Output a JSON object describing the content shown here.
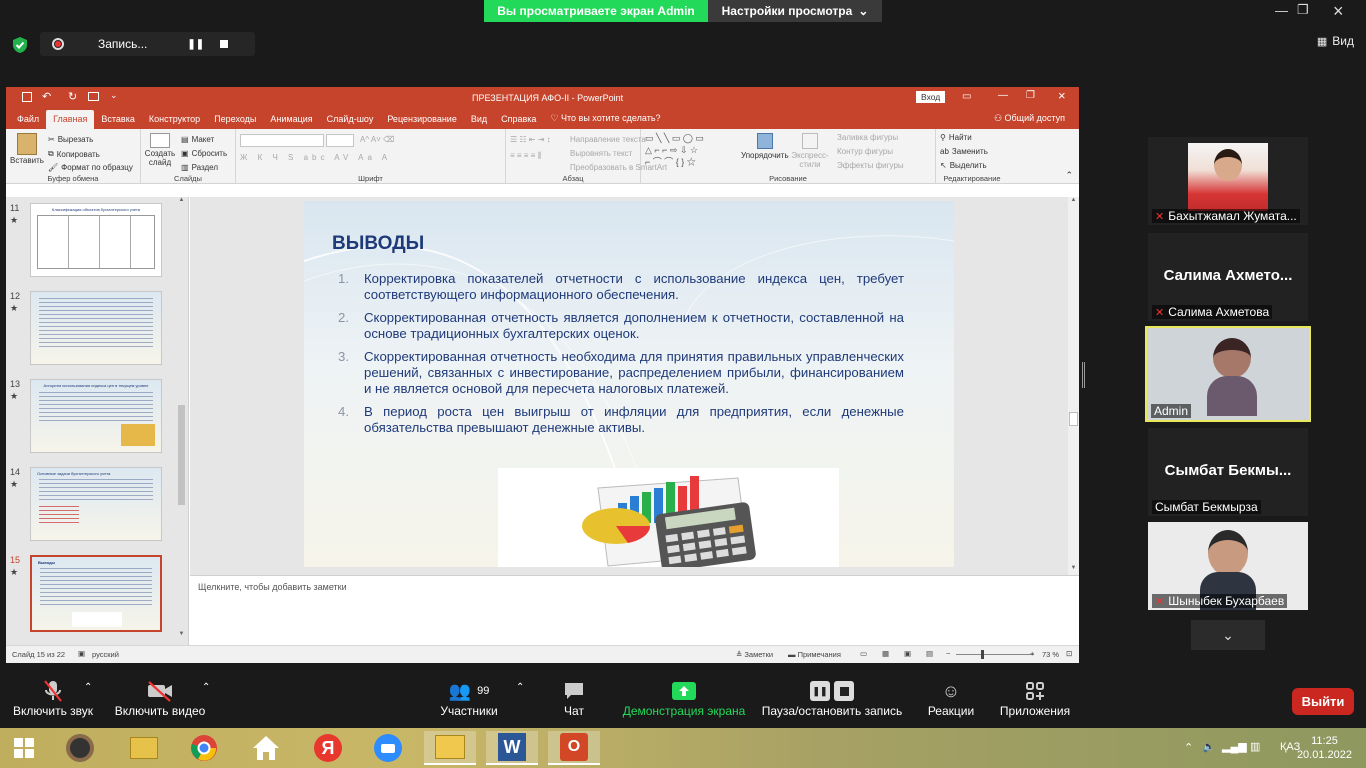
{
  "zoom": {
    "banner_text": "Вы просматриваете экран Admin",
    "view_options": "Настройки просмотра",
    "recording_label": "Запись...",
    "view_label": "Вид",
    "leave_label": "Выйти",
    "participants_count": "99",
    "toolbar": {
      "mute": "Включить звук",
      "video": "Включить видео",
      "participants": "Участники",
      "chat": "Чат",
      "share": "Демонстрация экрана",
      "record": "Пауза/остановить запись",
      "reactions": "Реакции",
      "apps": "Приложения"
    },
    "participants": [
      {
        "name": "Бахытжамал Жумата...",
        "big": "",
        "muted": true
      },
      {
        "name": "Салима Ахметова",
        "big": "Салима Ахмето...",
        "muted": true
      },
      {
        "name": "Admin",
        "big": "",
        "muted": false
      },
      {
        "name": "Сымбат Бекмырза",
        "big": "Сымбат Бекмы...",
        "muted": false
      },
      {
        "name": "Шыныбек Бухарбаев",
        "big": "",
        "muted": true
      }
    ]
  },
  "ppt": {
    "title": "ПРЕЗЕНТАЦИЯ АФО-II  -  PowerPoint",
    "signin": "Вход",
    "share": "Общий доступ",
    "tabs": [
      "Файл",
      "Главная",
      "Вставка",
      "Конструктор",
      "Переходы",
      "Анимация",
      "Слайд-шоу",
      "Рецензирование",
      "Вид",
      "Справка",
      "Что вы хотите сделать?"
    ],
    "ribbon": {
      "paste": "Вставить",
      "cut": "Вырезать",
      "copy": "Копировать",
      "format_painter": "Формат по образцу",
      "clipboard": "Буфер обмена",
      "create_slide": "Создать слайд",
      "layout": "Макет",
      "reset": "Сбросить",
      "section": "Раздел",
      "slides": "Слайды",
      "font": "Шрифт",
      "text_direction": "Направление текста",
      "align_text": "Выровнять текст",
      "smartart": "Преобразовать в SmartArt",
      "paragraph": "Абзац",
      "arrange": "Упорядочить",
      "express_styles": "Экспресс-стили",
      "shape_fill": "Заливка фигуры",
      "shape_outline": "Контур фигуры",
      "shape_effects": "Эффекты фигуры",
      "drawing": "Рисование",
      "find": "Найти",
      "replace": "Заменить",
      "select": "Выделить",
      "editing": "Редактирование"
    },
    "thumbnails": [
      {
        "num": "11",
        "title": "Классификация объектов бухгалтерского учета"
      },
      {
        "num": "12",
        "title": ""
      },
      {
        "num": "13",
        "title": "Алгоритм использования индекса цен в текущем уровне"
      },
      {
        "num": "14",
        "title": "Основные задачи бухгалтерского учета"
      },
      {
        "num": "15",
        "title": "Выводы"
      }
    ],
    "slide": {
      "title": "ВЫВОДЫ",
      "items": [
        {
          "n": "1.",
          "text": "Корректировка показателей отчетности с использование индекса цен, требует соответствующего информационного обеспечения."
        },
        {
          "n": "2.",
          "text": "Скорректированная отчетность является дополнением  к отчетности, составленной на основе традиционных бухгалтерских оценок."
        },
        {
          "n": "3.",
          "text": "Скорректированная отчетность необходима для принятия правильных управленческих решений, связанных с инвестирование, распределением прибыли, финансированием и не является основой для пересчета налоговых платежей."
        },
        {
          "n": "4.",
          "text": "В период роста цен выигрыш от инфляции для предприятия, если денежные обязательства превышают денежные активы."
        }
      ]
    },
    "notes_placeholder": "Щелкните, чтобы добавить заметки",
    "status": {
      "slide_of": "Слайд 15 из 22",
      "language": "русский",
      "notes": "Заметки",
      "comments": "Примечания",
      "zoom": "73 %"
    }
  },
  "taskbar": {
    "language": "ҚАЗ",
    "time": "11:25",
    "date": "20.01.2022"
  }
}
